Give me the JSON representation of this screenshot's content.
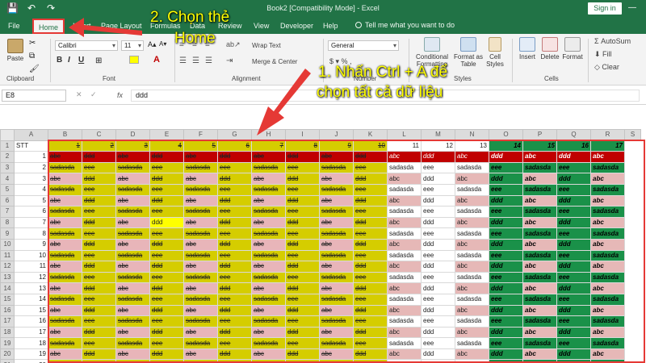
{
  "titlebar": {
    "title": "Book2  [Compatibility Mode]  -  Excel",
    "signin": "Sign in",
    "qa_save": "💾",
    "qa_undo": "↶",
    "qa_redo": "↷",
    "win_ctrl": "—  ☐  ✕"
  },
  "tabs": [
    "File",
    "Home",
    "Insert",
    "Page Layout",
    "Formulas",
    "Data",
    "Review",
    "View",
    "Developer",
    "Help"
  ],
  "tellme": "Tell me what you want to do",
  "ribbon": {
    "paste": "Paste",
    "clipboard": "Clipboard",
    "font_name": "Calibri",
    "font_size": "11",
    "font_group": "Font",
    "wrap_text": "Wrap Text",
    "merge_center": "Merge & Center",
    "alignment": "Alignment",
    "number_format": "General",
    "number": "Number",
    "conditional": "Conditional",
    "formatting": "Formatting",
    "format_as": "Format as",
    "table": "Table",
    "cell": "Cell",
    "styles_lbl": "Styles",
    "styles_group": "Styles",
    "insert": "Insert",
    "delete": "Delete",
    "format": "Format",
    "cells": "Cells",
    "autosum": "AutoSum",
    "fill": "Fill",
    "clear": "Clear",
    "bold": "B",
    "italic": "I",
    "underline": "U",
    "number_symbols": "$ ▾  %  ,"
  },
  "formula_bar": {
    "name_box": "E8",
    "fx": "fx",
    "formula": "ddd"
  },
  "grid": {
    "col_headers": [
      "A",
      "B",
      "C",
      "D",
      "E",
      "F",
      "G",
      "H",
      "I",
      "J",
      "K",
      "L",
      "M",
      "N",
      "O",
      "P",
      "Q",
      "R",
      "S"
    ],
    "row1": [
      "STT",
      "1",
      "",
      "2",
      "",
      "3",
      "",
      "4",
      "",
      "5",
      "",
      "6",
      "",
      "7",
      "",
      "8",
      "",
      "9",
      "",
      "10",
      "",
      "11",
      "",
      "12",
      "",
      "13",
      "14",
      "15",
      "16",
      "17"
    ],
    "rows": [
      {
        "n": "2",
        "a": "1"
      },
      {
        "n": "3",
        "a": "2"
      },
      {
        "n": "4",
        "a": "3"
      },
      {
        "n": "5",
        "a": "4"
      },
      {
        "n": "6",
        "a": "5"
      },
      {
        "n": "7",
        "a": "6"
      },
      {
        "n": "8",
        "a": "7"
      },
      {
        "n": "9",
        "a": "8"
      },
      {
        "n": "10",
        "a": "9"
      },
      {
        "n": "11",
        "a": "10"
      },
      {
        "n": "12",
        "a": "11"
      },
      {
        "n": "13",
        "a": "12"
      },
      {
        "n": "14",
        "a": "13"
      },
      {
        "n": "15",
        "a": "14"
      },
      {
        "n": "16",
        "a": "15"
      },
      {
        "n": "17",
        "a": "16"
      },
      {
        "n": "18",
        "a": "17"
      },
      {
        "n": "19",
        "a": "18"
      },
      {
        "n": "20",
        "a": "19"
      },
      {
        "n": "21",
        "a": "20"
      }
    ],
    "words": {
      "abc": "abc",
      "ddd": "ddd",
      "sadasda": "sadasda",
      "eee": "eee"
    }
  },
  "annotations": {
    "step2_line1": "2. Chọn thẻ",
    "step2_line2": "Home",
    "step1_line1": "1. Nhấn Ctrl + A để",
    "step1_line2": "chọn tất cả dữ liệu"
  },
  "colors": {
    "excel_green": "#217346",
    "yellow_fill": "#d5cd00",
    "green_fill": "#1a9149",
    "pink_fill": "#e6b8b7",
    "red_fill": "#c00000",
    "annotation_yellow": "#ffff00",
    "arrow_red": "#e53935"
  }
}
